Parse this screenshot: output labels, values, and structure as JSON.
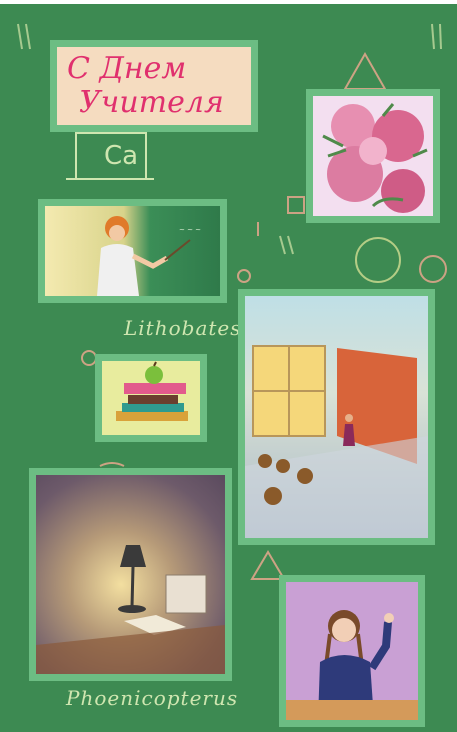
{
  "greeting": {
    "line1": "С Днем",
    "line2": "Учителя"
  },
  "board_notes": {
    "element_symbol": "Ca",
    "signature_top": "Lithobates",
    "signature_bottom": "Phoenicopterus"
  },
  "illustrations": [
    {
      "name": "flowers",
      "subject": "peony-flowers-icon"
    },
    {
      "name": "teacher",
      "subject": "teacher-at-blackboard-icon"
    },
    {
      "name": "books",
      "subject": "books-with-apple-icon"
    },
    {
      "name": "classroom",
      "subject": "classroom-lecture-icon"
    },
    {
      "name": "desk-lamp",
      "subject": "desk-lamp-with-books-icon"
    },
    {
      "name": "student",
      "subject": "student-raising-hand-icon"
    }
  ],
  "colors": {
    "chalkboard": "#3d8a52",
    "frame": "#6cbd83",
    "chalk": "#cfe6b0",
    "title_text": "#e0306e"
  }
}
